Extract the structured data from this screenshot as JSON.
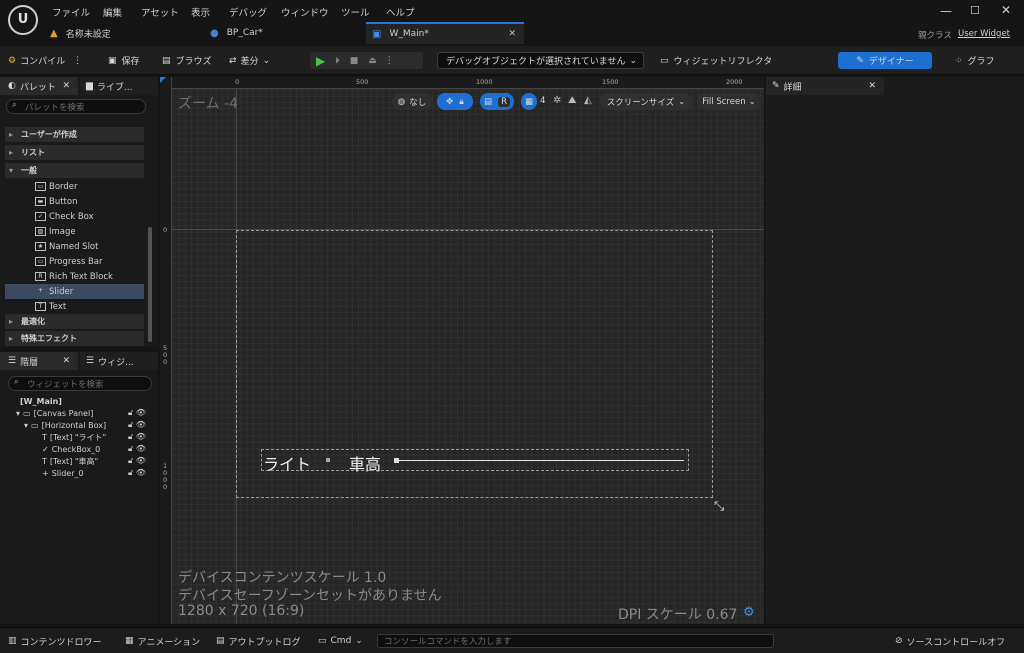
{
  "menu": [
    "ファイル",
    "編集",
    "アセット",
    "表示",
    "デバッグ",
    "ウィンドウ",
    "ツール",
    "ヘルプ"
  ],
  "tabs": [
    {
      "label": "名称未設定"
    },
    {
      "label": "BP_Car*"
    },
    {
      "label": "W_Main*"
    }
  ],
  "parent_class": {
    "label": "親クラス",
    "value": "User Widget"
  },
  "toolbar": {
    "compile": "コンパイル",
    "save": "保存",
    "browse": "ブラウズ",
    "diff": "差分",
    "debug_select": "デバッグオブジェクトが選択されていません",
    "widget_reflector": "ウィジェットリフレクタ",
    "designer": "デザイナー",
    "graph": "グラフ"
  },
  "palette": {
    "tab_palette": "パレット",
    "tab_library": "ライブ...",
    "search_placeholder": "パレットを検索",
    "categories": [
      "ユーザーが作成",
      "リスト",
      "一般",
      "最適化",
      "特殊エフェクト"
    ],
    "items": [
      {
        "label": "Border",
        "icon": "▭"
      },
      {
        "label": "Button",
        "icon": "▬"
      },
      {
        "label": "Check Box",
        "icon": "✓"
      },
      {
        "label": "Image",
        "icon": "▨"
      },
      {
        "label": "Named Slot",
        "icon": "★"
      },
      {
        "label": "Progress Bar",
        "icon": "▭"
      },
      {
        "label": "Rich Text Block",
        "icon": "R"
      },
      {
        "label": "Slider",
        "icon": "+"
      },
      {
        "label": "Text",
        "icon": "T"
      }
    ]
  },
  "hierarchy": {
    "tab_hierarchy": "階層",
    "tab_widget": "ウィジ...",
    "search_placeholder": "ウィジェットを検索",
    "rows": [
      "[W_Main]",
      "[Canvas Panel]",
      "[Horizontal Box]",
      "[Text] \"ライト\"",
      "CheckBox_0",
      "[Text] \"車高\"",
      "Slider_0"
    ]
  },
  "viewport": {
    "zoom": "ズーム -4",
    "btn_none": "なし",
    "btn_r": "R",
    "grid_num": "4",
    "screen_size": "スクリーンサイズ",
    "fill_screen": "Fill Screen",
    "ruler_top": [
      "0",
      "500",
      "1000",
      "1500",
      "2000"
    ],
    "ruler_left": [
      "0",
      "500",
      "1000"
    ],
    "widget_text1": "ライト",
    "widget_text2": "車高",
    "info_scale": "デバイスコンテンツスケール 1.0",
    "info_safe": "デバイスセーフゾーンセットがありません",
    "info_res": "1280 x 720 (16:9)",
    "dpi": "DPI スケール 0.67"
  },
  "details": {
    "title": "詳細"
  },
  "status": {
    "content_drawer": "コンテンツドロワー",
    "animation": "アニメーション",
    "output_log": "アウトプットログ",
    "cmd": "Cmd",
    "console_placeholder": "コンソールコマンドを入力します",
    "source_control": "ソースコントロールオフ"
  }
}
